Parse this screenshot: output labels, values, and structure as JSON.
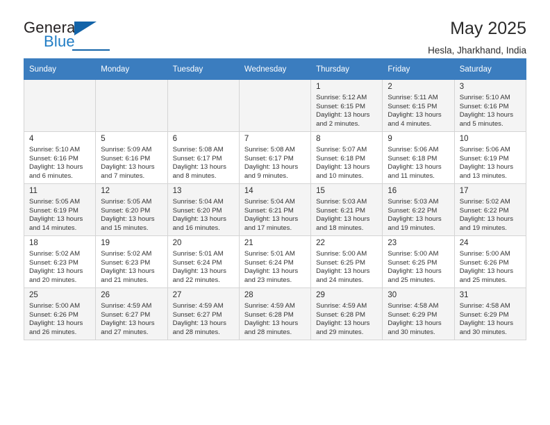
{
  "brand": {
    "name_part1": "General",
    "name_part2": "Blue",
    "triangle_icon": "triangle-logo-icon"
  },
  "header": {
    "title": "May 2025",
    "location": "Hesla, Jharkhand, India"
  },
  "calendar": {
    "weekdays": [
      "Sunday",
      "Monday",
      "Tuesday",
      "Wednesday",
      "Thursday",
      "Friday",
      "Saturday"
    ],
    "labels": {
      "sunrise": "Sunrise:",
      "sunset": "Sunset:",
      "daylight": "Daylight:"
    },
    "weeks": [
      [
        {
          "day": "",
          "empty": true
        },
        {
          "day": "",
          "empty": true
        },
        {
          "day": "",
          "empty": true
        },
        {
          "day": "",
          "empty": true
        },
        {
          "day": "1",
          "sunrise": "Sunrise: 5:12 AM",
          "sunset": "Sunset: 6:15 PM",
          "daylight1": "Daylight: 13 hours",
          "daylight2": "and 2 minutes."
        },
        {
          "day": "2",
          "sunrise": "Sunrise: 5:11 AM",
          "sunset": "Sunset: 6:15 PM",
          "daylight1": "Daylight: 13 hours",
          "daylight2": "and 4 minutes."
        },
        {
          "day": "3",
          "sunrise": "Sunrise: 5:10 AM",
          "sunset": "Sunset: 6:16 PM",
          "daylight1": "Daylight: 13 hours",
          "daylight2": "and 5 minutes."
        }
      ],
      [
        {
          "day": "4",
          "sunrise": "Sunrise: 5:10 AM",
          "sunset": "Sunset: 6:16 PM",
          "daylight1": "Daylight: 13 hours",
          "daylight2": "and 6 minutes."
        },
        {
          "day": "5",
          "sunrise": "Sunrise: 5:09 AM",
          "sunset": "Sunset: 6:16 PM",
          "daylight1": "Daylight: 13 hours",
          "daylight2": "and 7 minutes."
        },
        {
          "day": "6",
          "sunrise": "Sunrise: 5:08 AM",
          "sunset": "Sunset: 6:17 PM",
          "daylight1": "Daylight: 13 hours",
          "daylight2": "and 8 minutes."
        },
        {
          "day": "7",
          "sunrise": "Sunrise: 5:08 AM",
          "sunset": "Sunset: 6:17 PM",
          "daylight1": "Daylight: 13 hours",
          "daylight2": "and 9 minutes."
        },
        {
          "day": "8",
          "sunrise": "Sunrise: 5:07 AM",
          "sunset": "Sunset: 6:18 PM",
          "daylight1": "Daylight: 13 hours",
          "daylight2": "and 10 minutes."
        },
        {
          "day": "9",
          "sunrise": "Sunrise: 5:06 AM",
          "sunset": "Sunset: 6:18 PM",
          "daylight1": "Daylight: 13 hours",
          "daylight2": "and 11 minutes."
        },
        {
          "day": "10",
          "sunrise": "Sunrise: 5:06 AM",
          "sunset": "Sunset: 6:19 PM",
          "daylight1": "Daylight: 13 hours",
          "daylight2": "and 13 minutes."
        }
      ],
      [
        {
          "day": "11",
          "sunrise": "Sunrise: 5:05 AM",
          "sunset": "Sunset: 6:19 PM",
          "daylight1": "Daylight: 13 hours",
          "daylight2": "and 14 minutes."
        },
        {
          "day": "12",
          "sunrise": "Sunrise: 5:05 AM",
          "sunset": "Sunset: 6:20 PM",
          "daylight1": "Daylight: 13 hours",
          "daylight2": "and 15 minutes."
        },
        {
          "day": "13",
          "sunrise": "Sunrise: 5:04 AM",
          "sunset": "Sunset: 6:20 PM",
          "daylight1": "Daylight: 13 hours",
          "daylight2": "and 16 minutes."
        },
        {
          "day": "14",
          "sunrise": "Sunrise: 5:04 AM",
          "sunset": "Sunset: 6:21 PM",
          "daylight1": "Daylight: 13 hours",
          "daylight2": "and 17 minutes."
        },
        {
          "day": "15",
          "sunrise": "Sunrise: 5:03 AM",
          "sunset": "Sunset: 6:21 PM",
          "daylight1": "Daylight: 13 hours",
          "daylight2": "and 18 minutes."
        },
        {
          "day": "16",
          "sunrise": "Sunrise: 5:03 AM",
          "sunset": "Sunset: 6:22 PM",
          "daylight1": "Daylight: 13 hours",
          "daylight2": "and 19 minutes."
        },
        {
          "day": "17",
          "sunrise": "Sunrise: 5:02 AM",
          "sunset": "Sunset: 6:22 PM",
          "daylight1": "Daylight: 13 hours",
          "daylight2": "and 19 minutes."
        }
      ],
      [
        {
          "day": "18",
          "sunrise": "Sunrise: 5:02 AM",
          "sunset": "Sunset: 6:23 PM",
          "daylight1": "Daylight: 13 hours",
          "daylight2": "and 20 minutes."
        },
        {
          "day": "19",
          "sunrise": "Sunrise: 5:02 AM",
          "sunset": "Sunset: 6:23 PM",
          "daylight1": "Daylight: 13 hours",
          "daylight2": "and 21 minutes."
        },
        {
          "day": "20",
          "sunrise": "Sunrise: 5:01 AM",
          "sunset": "Sunset: 6:24 PM",
          "daylight1": "Daylight: 13 hours",
          "daylight2": "and 22 minutes."
        },
        {
          "day": "21",
          "sunrise": "Sunrise: 5:01 AM",
          "sunset": "Sunset: 6:24 PM",
          "daylight1": "Daylight: 13 hours",
          "daylight2": "and 23 minutes."
        },
        {
          "day": "22",
          "sunrise": "Sunrise: 5:00 AM",
          "sunset": "Sunset: 6:25 PM",
          "daylight1": "Daylight: 13 hours",
          "daylight2": "and 24 minutes."
        },
        {
          "day": "23",
          "sunrise": "Sunrise: 5:00 AM",
          "sunset": "Sunset: 6:25 PM",
          "daylight1": "Daylight: 13 hours",
          "daylight2": "and 25 minutes."
        },
        {
          "day": "24",
          "sunrise": "Sunrise: 5:00 AM",
          "sunset": "Sunset: 6:26 PM",
          "daylight1": "Daylight: 13 hours",
          "daylight2": "and 25 minutes."
        }
      ],
      [
        {
          "day": "25",
          "sunrise": "Sunrise: 5:00 AM",
          "sunset": "Sunset: 6:26 PM",
          "daylight1": "Daylight: 13 hours",
          "daylight2": "and 26 minutes."
        },
        {
          "day": "26",
          "sunrise": "Sunrise: 4:59 AM",
          "sunset": "Sunset: 6:27 PM",
          "daylight1": "Daylight: 13 hours",
          "daylight2": "and 27 minutes."
        },
        {
          "day": "27",
          "sunrise": "Sunrise: 4:59 AM",
          "sunset": "Sunset: 6:27 PM",
          "daylight1": "Daylight: 13 hours",
          "daylight2": "and 28 minutes."
        },
        {
          "day": "28",
          "sunrise": "Sunrise: 4:59 AM",
          "sunset": "Sunset: 6:28 PM",
          "daylight1": "Daylight: 13 hours",
          "daylight2": "and 28 minutes."
        },
        {
          "day": "29",
          "sunrise": "Sunrise: 4:59 AM",
          "sunset": "Sunset: 6:28 PM",
          "daylight1": "Daylight: 13 hours",
          "daylight2": "and 29 minutes."
        },
        {
          "day": "30",
          "sunrise": "Sunrise: 4:58 AM",
          "sunset": "Sunset: 6:29 PM",
          "daylight1": "Daylight: 13 hours",
          "daylight2": "and 30 minutes."
        },
        {
          "day": "31",
          "sunrise": "Sunrise: 4:58 AM",
          "sunset": "Sunset: 6:29 PM",
          "daylight1": "Daylight: 13 hours",
          "daylight2": "and 30 minutes."
        }
      ]
    ]
  },
  "colors": {
    "header_blue": "#3b7dbf",
    "brand_blue": "#1263a8",
    "row_shade": "#f4f4f4",
    "border": "#d4d4d4"
  }
}
